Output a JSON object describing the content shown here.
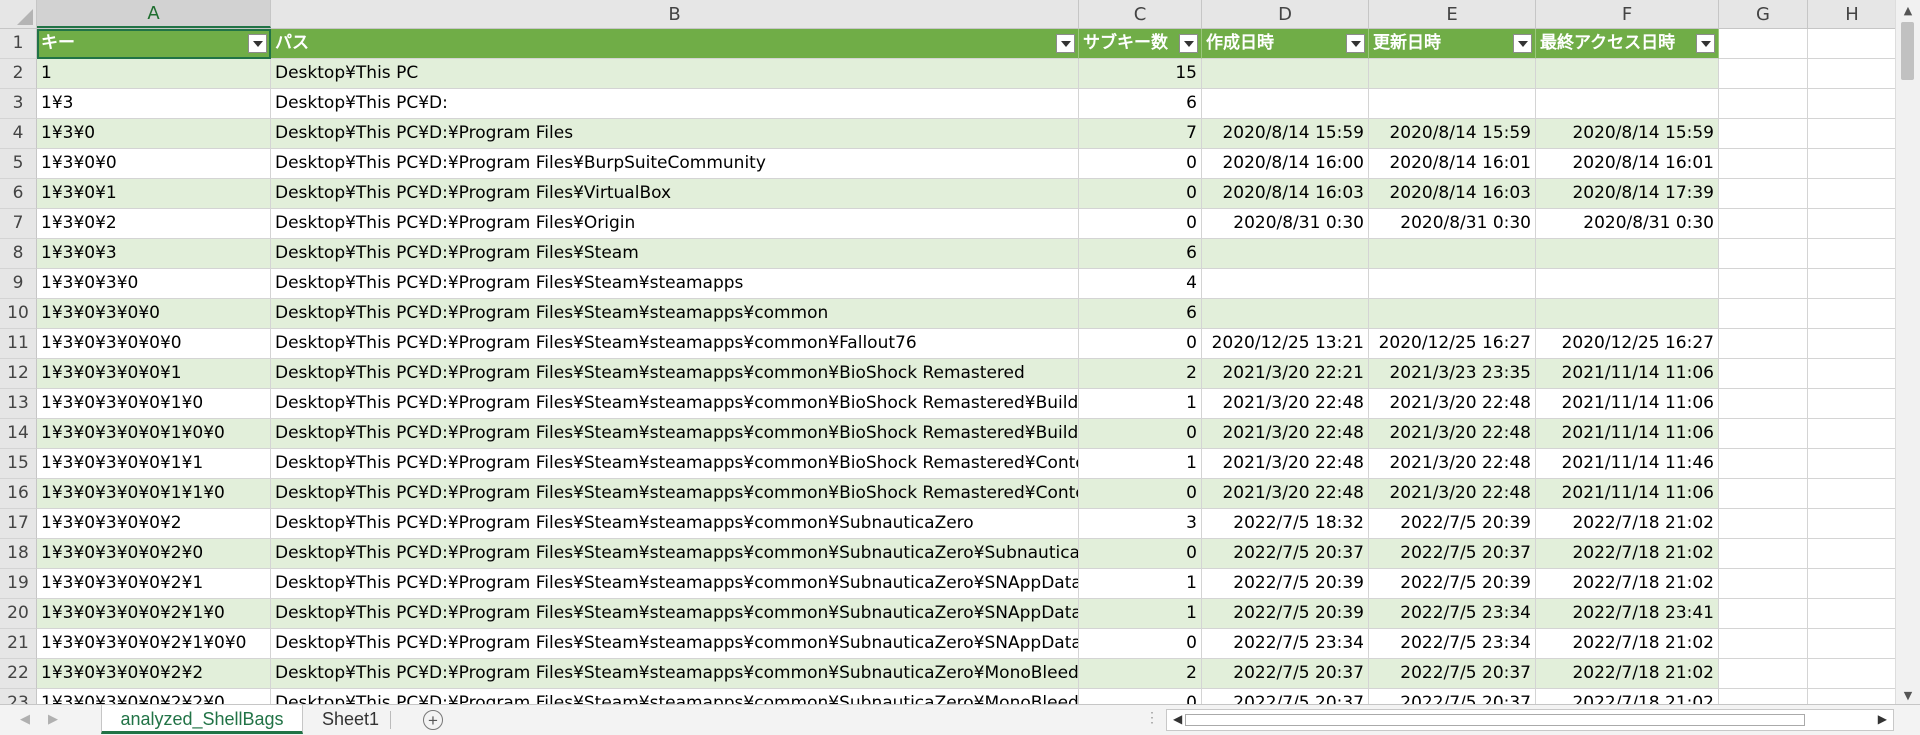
{
  "columns": [
    "A",
    "B",
    "C",
    "D",
    "E",
    "F",
    "G",
    "H"
  ],
  "header": {
    "key": "キー",
    "path": "パス",
    "subkeys": "サブキー数",
    "created": "作成日時",
    "modified": "更新日時",
    "accessed": "最終アクセス日時"
  },
  "rows": [
    {
      "n": "2",
      "key": "1",
      "path": "Desktop¥This PC",
      "sub": "15",
      "c": "",
      "m": "",
      "a": ""
    },
    {
      "n": "3",
      "key": "1¥3",
      "path": "Desktop¥This PC¥D:",
      "sub": "6",
      "c": "",
      "m": "",
      "a": ""
    },
    {
      "n": "4",
      "key": "1¥3¥0",
      "path": "Desktop¥This PC¥D:¥Program Files",
      "sub": "7",
      "c": "2020/8/14 15:59",
      "m": "2020/8/14 15:59",
      "a": "2020/8/14 15:59"
    },
    {
      "n": "5",
      "key": "1¥3¥0¥0",
      "path": "Desktop¥This PC¥D:¥Program Files¥BurpSuiteCommunity",
      "sub": "0",
      "c": "2020/8/14 16:00",
      "m": "2020/8/14 16:01",
      "a": "2020/8/14 16:01"
    },
    {
      "n": "6",
      "key": "1¥3¥0¥1",
      "path": "Desktop¥This PC¥D:¥Program Files¥VirtualBox",
      "sub": "0",
      "c": "2020/8/14 16:03",
      "m": "2020/8/14 16:03",
      "a": "2020/8/14 17:39"
    },
    {
      "n": "7",
      "key": "1¥3¥0¥2",
      "path": "Desktop¥This PC¥D:¥Program Files¥Origin",
      "sub": "0",
      "c": "2020/8/31 0:30",
      "m": "2020/8/31 0:30",
      "a": "2020/8/31 0:30"
    },
    {
      "n": "8",
      "key": "1¥3¥0¥3",
      "path": "Desktop¥This PC¥D:¥Program Files¥Steam",
      "sub": "6",
      "c": "",
      "m": "",
      "a": ""
    },
    {
      "n": "9",
      "key": "1¥3¥0¥3¥0",
      "path": "Desktop¥This PC¥D:¥Program Files¥Steam¥steamapps",
      "sub": "4",
      "c": "",
      "m": "",
      "a": ""
    },
    {
      "n": "10",
      "key": "1¥3¥0¥3¥0¥0",
      "path": "Desktop¥This PC¥D:¥Program Files¥Steam¥steamapps¥common",
      "sub": "6",
      "c": "",
      "m": "",
      "a": ""
    },
    {
      "n": "11",
      "key": "1¥3¥0¥3¥0¥0¥0",
      "path": "Desktop¥This PC¥D:¥Program Files¥Steam¥steamapps¥common¥Fallout76",
      "sub": "0",
      "c": "2020/12/25 13:21",
      "m": "2020/12/25 16:27",
      "a": "2020/12/25 16:27"
    },
    {
      "n": "12",
      "key": "1¥3¥0¥3¥0¥0¥1",
      "path": "Desktop¥This PC¥D:¥Program Files¥Steam¥steamapps¥common¥BioShock Remastered",
      "sub": "2",
      "c": "2021/3/20 22:21",
      "m": "2021/3/23 23:35",
      "a": "2021/11/14 11:06"
    },
    {
      "n": "13",
      "key": "1¥3¥0¥3¥0¥0¥1¥0",
      "path": "Desktop¥This PC¥D:¥Program Files¥Steam¥steamapps¥common¥BioShock Remastered¥Build",
      "sub": "1",
      "c": "2021/3/20 22:48",
      "m": "2021/3/20 22:48",
      "a": "2021/11/14 11:06"
    },
    {
      "n": "14",
      "key": "1¥3¥0¥3¥0¥0¥1¥0¥0",
      "path": "Desktop¥This PC¥D:¥Program Files¥Steam¥steamapps¥common¥BioShock Remastered¥Build¥F",
      "sub": "0",
      "c": "2021/3/20 22:48",
      "m": "2021/3/20 22:48",
      "a": "2021/11/14 11:06"
    },
    {
      "n": "15",
      "key": "1¥3¥0¥3¥0¥0¥1¥1",
      "path": "Desktop¥This PC¥D:¥Program Files¥Steam¥steamapps¥common¥BioShock Remastered¥Content",
      "sub": "1",
      "c": "2021/3/20 22:48",
      "m": "2021/3/20 22:48",
      "a": "2021/11/14 11:46"
    },
    {
      "n": "16",
      "key": "1¥3¥0¥3¥0¥0¥1¥1¥0",
      "path": "Desktop¥This PC¥D:¥Program Files¥Steam¥steamapps¥common¥BioShock Remastered¥Content",
      "sub": "0",
      "c": "2021/3/20 22:48",
      "m": "2021/3/20 22:48",
      "a": "2021/11/14 11:06"
    },
    {
      "n": "17",
      "key": "1¥3¥0¥3¥0¥0¥2",
      "path": "Desktop¥This PC¥D:¥Program Files¥Steam¥steamapps¥common¥SubnauticaZero",
      "sub": "3",
      "c": "2022/7/5 18:32",
      "m": "2022/7/5 20:39",
      "a": "2022/7/18 21:02"
    },
    {
      "n": "18",
      "key": "1¥3¥0¥3¥0¥0¥2¥0",
      "path": "Desktop¥This PC¥D:¥Program Files¥Steam¥steamapps¥common¥SubnauticaZero¥SubnauticaZe",
      "sub": "0",
      "c": "2022/7/5 20:37",
      "m": "2022/7/5 20:37",
      "a": "2022/7/18 21:02"
    },
    {
      "n": "19",
      "key": "1¥3¥0¥3¥0¥0¥2¥1",
      "path": "Desktop¥This PC¥D:¥Program Files¥Steam¥steamapps¥common¥SubnauticaZero¥SNAppData",
      "sub": "1",
      "c": "2022/7/5 20:39",
      "m": "2022/7/5 20:39",
      "a": "2022/7/18 21:02"
    },
    {
      "n": "20",
      "key": "1¥3¥0¥3¥0¥0¥2¥1¥0",
      "path": "Desktop¥This PC¥D:¥Program Files¥Steam¥steamapps¥common¥SubnauticaZero¥SNAppData¥S",
      "sub": "1",
      "c": "2022/7/5 20:39",
      "m": "2022/7/5 23:34",
      "a": "2022/7/18 23:41"
    },
    {
      "n": "21",
      "key": "1¥3¥0¥3¥0¥0¥2¥1¥0¥0",
      "path": "Desktop¥This PC¥D:¥Program Files¥Steam¥steamapps¥common¥SubnauticaZero¥SNAppData¥S",
      "sub": "0",
      "c": "2022/7/5 23:34",
      "m": "2022/7/5 23:34",
      "a": "2022/7/18 21:02"
    },
    {
      "n": "22",
      "key": "1¥3¥0¥3¥0¥0¥2¥2",
      "path": "Desktop¥This PC¥D:¥Program Files¥Steam¥steamapps¥common¥SubnauticaZero¥MonoBleeding",
      "sub": "2",
      "c": "2022/7/5 20:37",
      "m": "2022/7/5 20:37",
      "a": "2022/7/18 21:02"
    },
    {
      "n": "23",
      "key": "1¥3¥0¥3¥0¥0¥2¥2¥0",
      "path": "Desktop¥This PC¥D:¥Program Files¥Steam¥steamapps¥common¥SubnauticaZero¥MonoBleeding",
      "sub": "0",
      "c": "2022/7/5 20:37",
      "m": "2022/7/5 20:37",
      "a": "2022/7/18 21:02"
    }
  ],
  "tabs": {
    "active": "analyzed_ShellBags",
    "other": "Sheet1",
    "add": "+"
  },
  "colors": {
    "header_green": "#70ad47",
    "band_green": "#e2efda",
    "accent": "#217346"
  }
}
